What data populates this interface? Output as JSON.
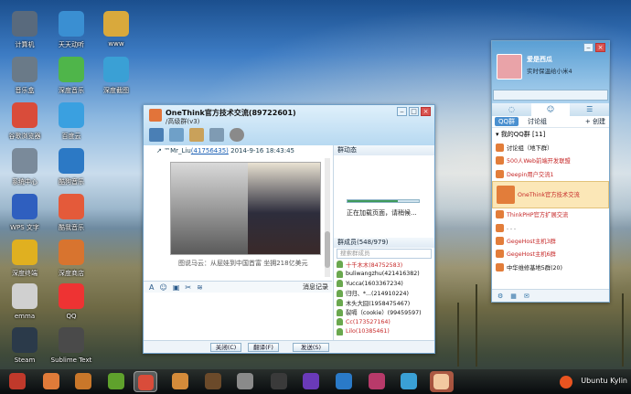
{
  "desktop": {
    "icons": [
      {
        "label": "计算机",
        "color": "#596a7d"
      },
      {
        "label": "天天动听",
        "color": "#3a8fd2"
      },
      {
        "label": "www",
        "color": "#d9a93c"
      },
      {
        "label": "音乐盒",
        "color": "#6a7a88"
      },
      {
        "label": "深度音乐",
        "color": "#4fb54a"
      },
      {
        "label": "深度截图",
        "color": "#3aa0d5"
      },
      {
        "label": "谷歌浏览器",
        "color": "#d94c3a"
      },
      {
        "label": "百度云",
        "color": "#3aa0e0"
      },
      {
        "label": "系统中心",
        "color": "#7a8a9a"
      },
      {
        "label": "酷狗音乐",
        "color": "#2c79c5"
      },
      {
        "label": "WPS 文字",
        "color": "#2f5fbf"
      },
      {
        "label": "酷我音乐",
        "color": "#e45a3a"
      },
      {
        "label": "深度终端",
        "color": "#e0b020"
      },
      {
        "label": "深度商店",
        "color": "#d8742f"
      },
      {
        "label": "emma",
        "color": "#d0d0d0"
      },
      {
        "label": "QQ",
        "color": "#e33"
      },
      {
        "label": "Steam",
        "color": "#2b3a4a"
      },
      {
        "label": "Sublime Text",
        "color": "#4a4a4a"
      }
    ]
  },
  "chat": {
    "title": "OneThink官方技术交流(89722601)",
    "subtitle": "/高级群(v3)",
    "message_header_prefix": "↗ ™Mr_Liu",
    "message_header_id": "(41756435)",
    "message_time": "2014-9-16 18:43:45",
    "caption": "图说马云：从屁娃到中国首富 坐拥218亿美元",
    "record_label": "消息记录",
    "close_btn": "关闭(C)",
    "translate_btn": "翻译(F)",
    "send_btn": "发送(S)",
    "side_title": "群动态",
    "loading_text": "正在加载页面，请稍候...",
    "loading_progress": 0.7,
    "members_title": "群成员(548/979)",
    "member_search_placeholder": "搜索群成员",
    "members": [
      {
        "name": "十千木木(84752583)",
        "color": "#c62828"
      },
      {
        "name": "buliwangzhu(421416382)",
        "color": "#111"
      },
      {
        "name": "Yucca(1603367234)",
        "color": "#111"
      },
      {
        "name": "归归、*...(214910224)",
        "color": "#111"
      },
      {
        "name": "木头大囧(1958475467)",
        "color": "#111"
      },
      {
        "name": "裂嗝（cookie）(99459597)",
        "color": "#111"
      },
      {
        "name": "Cc(173527164)",
        "color": "#c62828"
      },
      {
        "name": "Lilo(10385461)",
        "color": "#c62828"
      }
    ]
  },
  "qq": {
    "nickname": "爱是西瓜",
    "signature": "实时保温给小米4",
    "tabs": [
      "◌",
      "☺",
      "☰"
    ],
    "sub_tab_groups": "QQ群",
    "sub_tab_discuss": "讨论组",
    "sub_tab_create": "+ 创建",
    "group_header": "▾ 我的QQ群 [11]",
    "groups": [
      {
        "name": "讨论组（地下群）",
        "color": "#111"
      },
      {
        "name": "500人Web前端开发联盟",
        "color": "#c62828"
      },
      {
        "name": "Deepin用户交流1",
        "color": "#c62828"
      },
      {
        "name": "OneThink官方技术交流",
        "color": "#c62828",
        "selected": true
      },
      {
        "name": "ThinkPHP官方扩展交流",
        "color": "#c62828"
      },
      {
        "name": ". . .",
        "color": "#111"
      },
      {
        "name": "GegeHost主机3群",
        "color": "#c62828"
      },
      {
        "name": "GegeHost主机6群",
        "color": "#c62828"
      },
      {
        "name": "中华维修基地5群(20)",
        "color": "#111"
      }
    ]
  },
  "dock": {
    "brand": "Ubuntu Kylin"
  }
}
